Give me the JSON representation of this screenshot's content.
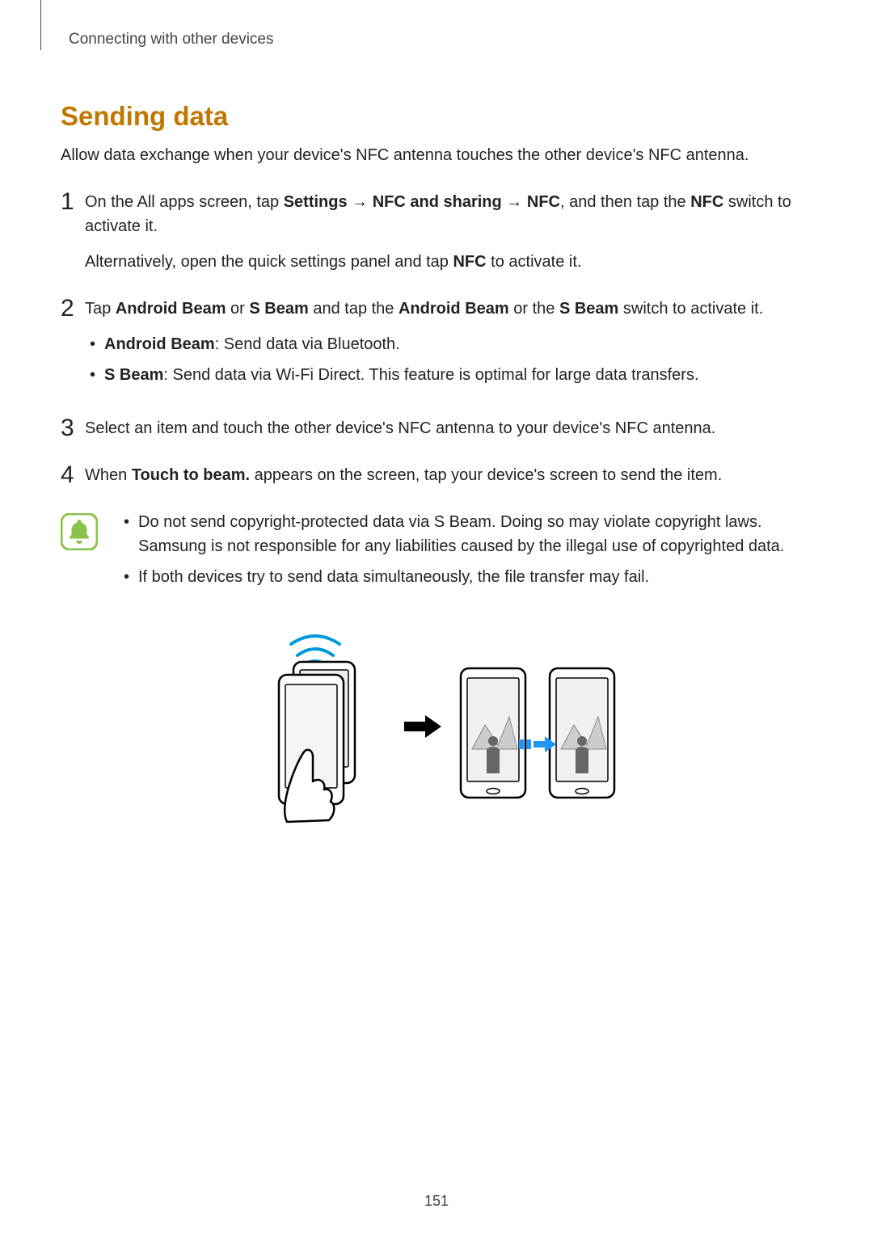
{
  "header": {
    "chapter": "Connecting with other devices"
  },
  "section": {
    "title": "Sending data",
    "intro": "Allow data exchange when your device's NFC antenna touches the other device's NFC antenna."
  },
  "steps": {
    "s1": {
      "num": "1",
      "part1a": "On the All apps screen, tap ",
      "bold_settings": "Settings",
      "arrow1": " → ",
      "bold_nfc_sharing": "NFC and sharing",
      "arrow2": " → ",
      "bold_nfc": "NFC",
      "part1b": ", and then tap the ",
      "bold_nfc2": "NFC",
      "part1c": " switch to activate it.",
      "alt_a": "Alternatively, open the quick settings panel and tap ",
      "alt_bold": "NFC",
      "alt_b": " to activate it."
    },
    "s2": {
      "num": "2",
      "a": "Tap ",
      "bold_ab": "Android Beam",
      "b": " or ",
      "bold_sb": "S Beam",
      "c": " and tap the ",
      "bold_ab2": "Android Beam",
      "d": " or the ",
      "bold_sb2": "S Beam",
      "e": " switch to activate it.",
      "bullet1_bold": "Android Beam",
      "bullet1_rest": ": Send data via Bluetooth.",
      "bullet2_bold": "S Beam",
      "bullet2_rest": ": Send data via Wi-Fi Direct. This feature is optimal for large data transfers."
    },
    "s3": {
      "num": "3",
      "text": "Select an item and touch the other device's NFC antenna to your device's NFC antenna."
    },
    "s4": {
      "num": "4",
      "a": "When ",
      "bold": "Touch to beam.",
      "b": " appears on the screen, tap your device's screen to send the item."
    }
  },
  "note": {
    "b1": "Do not send copyright-protected data via S Beam. Doing so may violate copyright laws. Samsung is not responsible for any liabilities caused by the illegal use of copyrighted data.",
    "b2": "If both devices try to send data simultaneously, the file transfer may fail."
  },
  "page_number": "151"
}
